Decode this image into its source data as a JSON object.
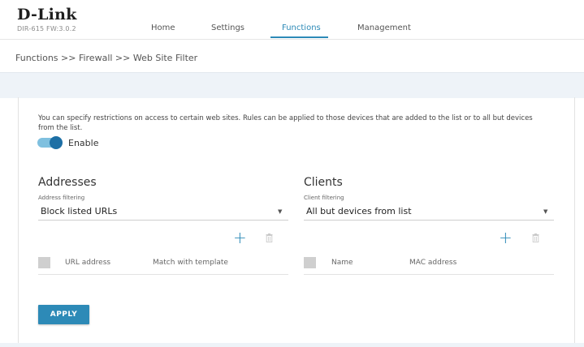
{
  "brand": {
    "logo": "D-Link",
    "firmware": "DIR-615 FW:3.0.2"
  },
  "nav": {
    "items": [
      {
        "label": "Home"
      },
      {
        "label": "Settings"
      },
      {
        "label": "Functions",
        "active": true
      },
      {
        "label": "Management"
      }
    ]
  },
  "breadcrumb": "Functions >> Firewall >> Web Site Filter",
  "description": "You can specify restrictions on access to certain web sites. Rules can be applied to those devices that are added to the list or to all but devices from the list.",
  "enable": {
    "label": "Enable",
    "on": true
  },
  "addresses": {
    "title": "Addresses",
    "filter_label": "Address filtering",
    "filter_value": "Block listed URLs",
    "columns": [
      "URL address",
      "Match with template"
    ]
  },
  "clients": {
    "title": "Clients",
    "filter_label": "Client filtering",
    "filter_value": "All but devices from list",
    "columns": [
      "Name",
      "MAC address"
    ]
  },
  "apply_label": "APPLY",
  "colors": {
    "accent": "#2d8ab7",
    "band": "#eef3f8"
  },
  "icons": {
    "add": "plus-icon",
    "delete": "trash-icon",
    "dropdown": "caret-down-icon"
  }
}
